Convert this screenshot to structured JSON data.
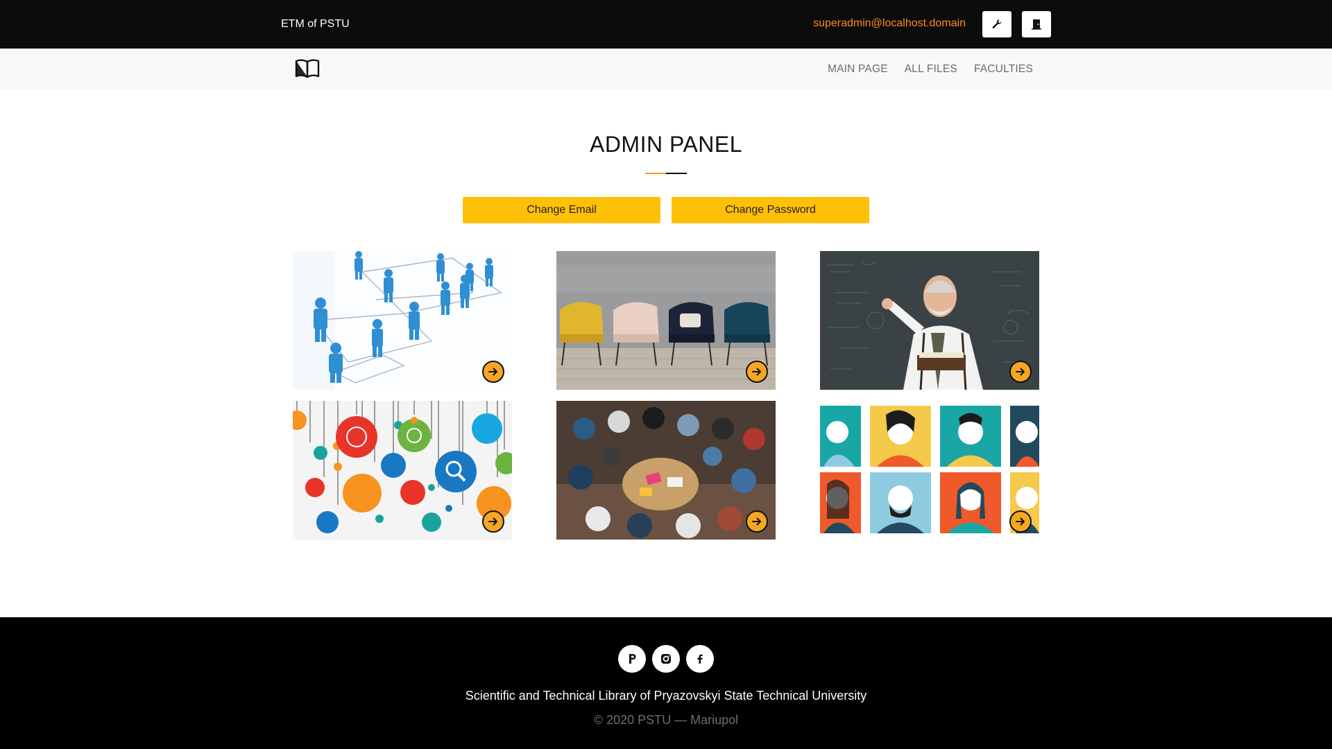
{
  "header": {
    "brand": "ETM of PSTU",
    "user_email": "superadmin@localhost.domain",
    "icons": [
      "wrench-icon",
      "door-exit-icon"
    ]
  },
  "nav": {
    "logo_icon": "open-book-icon",
    "links": [
      {
        "label": "MAIN PAGE"
      },
      {
        "label": "ALL FILES"
      },
      {
        "label": "FACULTIES"
      }
    ]
  },
  "main": {
    "title": "ADMIN PANEL",
    "accent_colors": {
      "underline_left": "#f39c12",
      "underline_right": "#111111",
      "button": "#ffc107",
      "email": "#ff8c1a"
    },
    "buttons": {
      "change_email": "Change Email",
      "change_password": "Change Password"
    },
    "tiles": [
      {
        "image": "people-network-hierarchy",
        "icon": "arrow-right-circle-icon"
      },
      {
        "image": "armchairs-row",
        "icon": "arrow-right-circle-icon"
      },
      {
        "image": "professor-with-book",
        "icon": "arrow-right-circle-icon"
      },
      {
        "image": "hanging-science-icons",
        "icon": "arrow-right-circle-icon"
      },
      {
        "image": "students-group-table",
        "icon": "arrow-right-circle-icon"
      },
      {
        "image": "people-avatars-grid",
        "icon": "arrow-right-circle-icon"
      }
    ]
  },
  "footer": {
    "socials": [
      "pstu-p-icon",
      "instagram-icon",
      "facebook-icon"
    ],
    "library": "Scientific and Technical Library of Pryazovskyi State Technical University",
    "copyright": "© 2020 PSTU — Mariupol"
  }
}
